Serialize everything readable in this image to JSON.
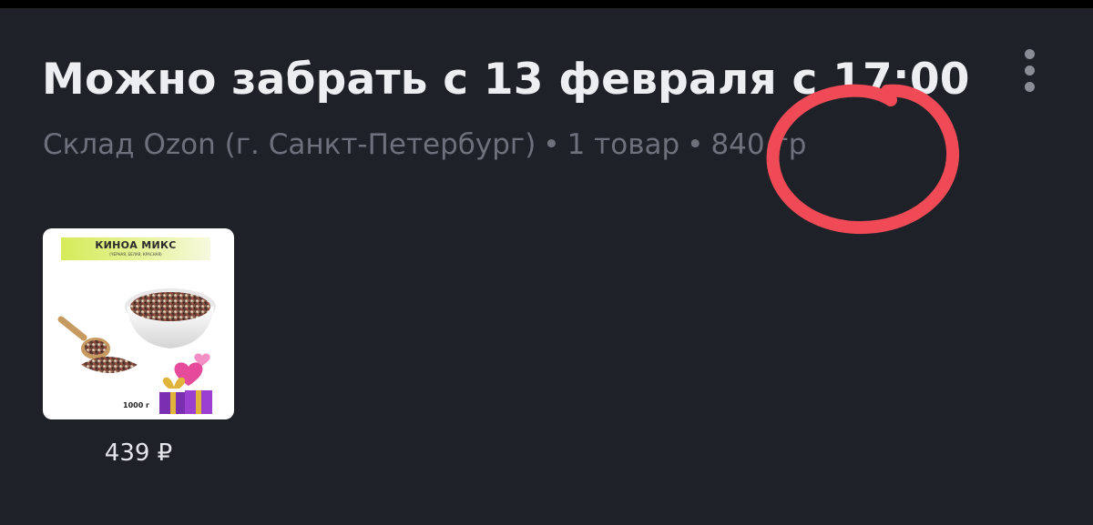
{
  "header": {
    "title": "Можно забрать с 13 февраля с 17:00",
    "subtitle": {
      "warehouse": "Склад Ozon (г. Санкт-Петербург)",
      "separator": "•",
      "item_count": "1 товар",
      "weight": "840 гр"
    },
    "menu_icon": "more-vertical-icon"
  },
  "product": {
    "banner_title": "КИНОА МИКС",
    "banner_subtitle": "(ЧЕРНАЯ, БЕЛАЯ, КРАСНАЯ)",
    "pack_weight": "1000 г",
    "price": "439 ₽"
  },
  "colors": {
    "background": "#1f2129",
    "title": "#eceef2",
    "subtitle": "#6e717b",
    "annotation": "#ef4a55"
  }
}
